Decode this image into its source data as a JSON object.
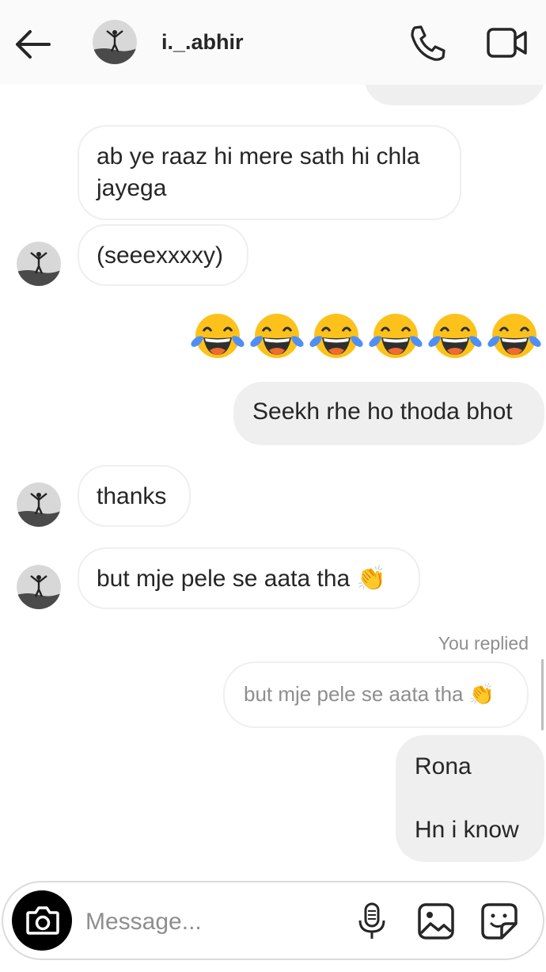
{
  "header": {
    "username": "i._.abhir",
    "back_icon": "arrow-left-icon",
    "call_icon": "phone-icon",
    "video_icon": "video-camera-icon"
  },
  "messages": [
    {
      "id": "m1",
      "side": "in",
      "text": "ab ye raaz hi mere sath hi chla jayega"
    },
    {
      "id": "m2",
      "side": "in",
      "text": "(seeexxxxy)"
    },
    {
      "id": "m3",
      "side": "out",
      "text": "😂😂😂😂😂😂",
      "emoji_count": 6
    },
    {
      "id": "m4",
      "side": "out",
      "text": "Seekh rhe ho thoda bhot"
    },
    {
      "id": "m5",
      "side": "in",
      "text": "thanks"
    },
    {
      "id": "m6",
      "side": "in",
      "text": "but mje pele se aata tha 👏"
    },
    {
      "id": "m7",
      "side": "out",
      "reply_label": "You replied",
      "quoted": "but mje pele se aata tha 👏"
    },
    {
      "id": "m8",
      "side": "out",
      "line1": "Rona",
      "line2": "Hn i know"
    }
  ],
  "composer": {
    "placeholder": "Message...",
    "camera_icon": "camera-icon",
    "mic_icon": "microphone-icon",
    "gallery_icon": "image-icon",
    "sticker_icon": "sticker-icon"
  },
  "colors": {
    "header_bg": "#fafafa",
    "outgoing_bubble": "#efefef",
    "incoming_border": "#efefef",
    "muted_text": "#8e8e8e",
    "camera_button": "#000000"
  }
}
